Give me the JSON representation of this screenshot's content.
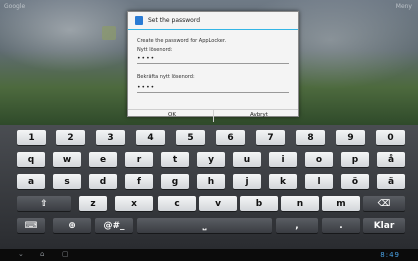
{
  "status_bar": {
    "left_text": "Google",
    "right_text": "Meny"
  },
  "dialog": {
    "title": "Set the password",
    "message": "Create the password for AppLocker.",
    "new_password_label": "Nytt lösenord:",
    "new_password_value": "••••",
    "confirm_password_label": "Bekräfta nytt lösenord:",
    "confirm_password_value": "••••",
    "ok_label": "OK",
    "cancel_label": "Avbryt"
  },
  "keyboard": {
    "row1": [
      "1",
      "2",
      "3",
      "4",
      "5",
      "6",
      "7",
      "8",
      "9",
      "0"
    ],
    "row2": [
      "q",
      "w",
      "e",
      "r",
      "t",
      "y",
      "u",
      "i",
      "o",
      "p",
      "å"
    ],
    "row3": [
      "a",
      "s",
      "d",
      "f",
      "g",
      "h",
      "j",
      "k",
      "l",
      "ö",
      "ä"
    ],
    "row4": [
      "⇧",
      "z",
      "x",
      "c",
      "v",
      "b",
      "n",
      "m",
      "⌫"
    ],
    "row5": [
      "⌨",
      "⊕",
      "@#_",
      "⎵",
      ",",
      ".",
      "Klar"
    ]
  },
  "nav_bar": {
    "back_icon": "back-icon",
    "home_icon": "home-icon",
    "recent_icon": "recent-apps-icon",
    "time": "8:49"
  },
  "colors": {
    "dialog_accent": "#33b5e5",
    "keyboard_bg": "#2a2c30",
    "clock": "#4aa3e6"
  }
}
